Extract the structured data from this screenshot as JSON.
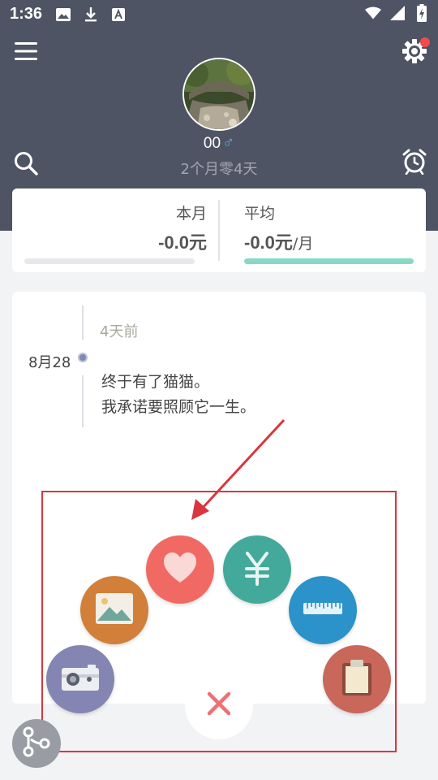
{
  "status_bar": {
    "time": "1:36"
  },
  "profile": {
    "name": "00",
    "gender_symbol": "♂",
    "age": "2个月零4天"
  },
  "stats": {
    "month": {
      "label": "本月",
      "value": "-0.0元",
      "unit": ""
    },
    "average": {
      "label": "平均",
      "value": "-0.0元",
      "unit": "/月"
    }
  },
  "timeline": {
    "entries": [
      {
        "ago": "4天前",
        "date": "8月28",
        "lines": [
          "终于有了猫猫。",
          "我承诺要照顾它一生。"
        ]
      }
    ]
  },
  "fab_menu": {
    "items": [
      {
        "icon": "heart-icon",
        "color": "#f06a63"
      },
      {
        "icon": "yen-icon",
        "color": "#43a99a"
      },
      {
        "icon": "photo-icon",
        "color": "#d27f3a"
      },
      {
        "icon": "ruler-icon",
        "color": "#2b93c9"
      },
      {
        "icon": "camera-icon",
        "color": "#8585b4"
      },
      {
        "icon": "clipboard-icon",
        "color": "#c8675a"
      },
      {
        "icon": "close-icon",
        "color": "#ef6f74"
      }
    ]
  },
  "colors": {
    "header_bg": "#4e5463",
    "accent_teal": "#88d8c6",
    "annotation_red": "#d9363e"
  }
}
